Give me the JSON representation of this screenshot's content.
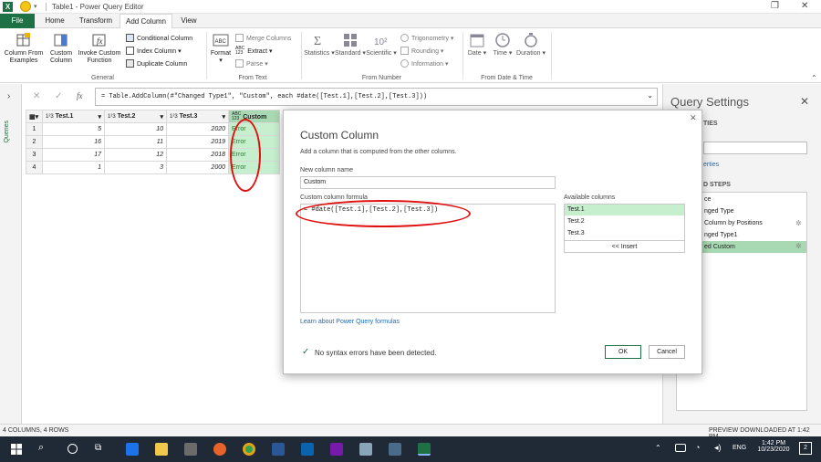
{
  "window": {
    "title": "Table1 - Power Query Editor",
    "app_icon": "X"
  },
  "tabs": [
    "File",
    "Home",
    "Transform",
    "Add Column",
    "View"
  ],
  "ribbon": {
    "general": {
      "column_from_examples": "Column From\nExamples",
      "custom_column": "Custom\nColumn",
      "invoke_custom_function": "Invoke Custom\nFunction",
      "conditional_column": "Conditional Column",
      "index_column": "Index Column",
      "duplicate_column": "Duplicate Column",
      "group": "General"
    },
    "from_text": {
      "format": "Format",
      "merge_columns": "Merge Columns",
      "extract": "Extract",
      "parse": "Parse",
      "group": "From Text",
      "abc_icon": "ABC",
      "abc_123": "ABC\n123"
    },
    "from_number": {
      "statistics": "Statistics",
      "standard": "Standard",
      "scientific": "Scientific",
      "trigonometry": "Trigonometry",
      "rounding": "Rounding",
      "information": "Information",
      "group": "From Number",
      "ten_squared": "10²"
    },
    "from_date_time": {
      "date": "Date",
      "time": "Time",
      "duration": "Duration",
      "group": "From Date & Time"
    }
  },
  "left_pane": {
    "label": "Queries"
  },
  "formula_bar": {
    "fx": "fx",
    "formula": "= Table.AddColumn(#\"Changed Type1\", \"Custom\", each #date([Test.1],[Test.2],[Test.3]))"
  },
  "grid": {
    "columns": [
      "Test.1",
      "Test.2",
      "Test.3",
      "Custom"
    ],
    "type_icons": [
      "1²3",
      "1²3",
      "1²3",
      "ABC\n123"
    ],
    "rows": [
      {
        "n": "1",
        "t1": "5",
        "t2": "10",
        "t3": "2020",
        "c": "Error"
      },
      {
        "n": "2",
        "t1": "16",
        "t2": "11",
        "t3": "2019",
        "c": "Error"
      },
      {
        "n": "3",
        "t1": "17",
        "t2": "12",
        "t3": "2018",
        "c": "Error"
      },
      {
        "n": "4",
        "t1": "1",
        "t2": "3",
        "t3": "2000",
        "c": "Error"
      }
    ]
  },
  "query_settings": {
    "title": "Query Settings",
    "properties": "TIES",
    "all_properties": "erties",
    "applied_steps": "D STEPS",
    "steps": [
      "ce",
      "Column by Positions",
      "nged Type",
      "nged Type1",
      "ed Custom"
    ]
  },
  "dialog": {
    "title": "Custom Column",
    "description": "Add a column that is computed from the other columns.",
    "new_column_label": "New column name",
    "new_column_value": "Custom",
    "formula_label": "Custom column formula",
    "formula_value": "= #date([Test.1],[Test.2],[Test.3])",
    "available_label": "Available columns",
    "available_columns": [
      "Test.1",
      "Test.2",
      "Test.3"
    ],
    "insert": "<< Insert",
    "learn_link": "Learn about Power Query formulas",
    "status": "No syntax errors have been detected.",
    "ok": "OK",
    "cancel": "Cancel"
  },
  "status_bar": {
    "left": "4 COLUMNS, 4 ROWS",
    "right": "PREVIEW DOWNLOADED AT 1:42 PM"
  },
  "taskbar": {
    "lang": "ENG",
    "time": "1:42 PM",
    "date": "10/23/2020",
    "notif": "2"
  },
  "colors": {
    "excel_green": "#1e7145",
    "error_green": "#c6efce",
    "annotation_red": "#e01010",
    "taskbar": "#1f2a36"
  }
}
